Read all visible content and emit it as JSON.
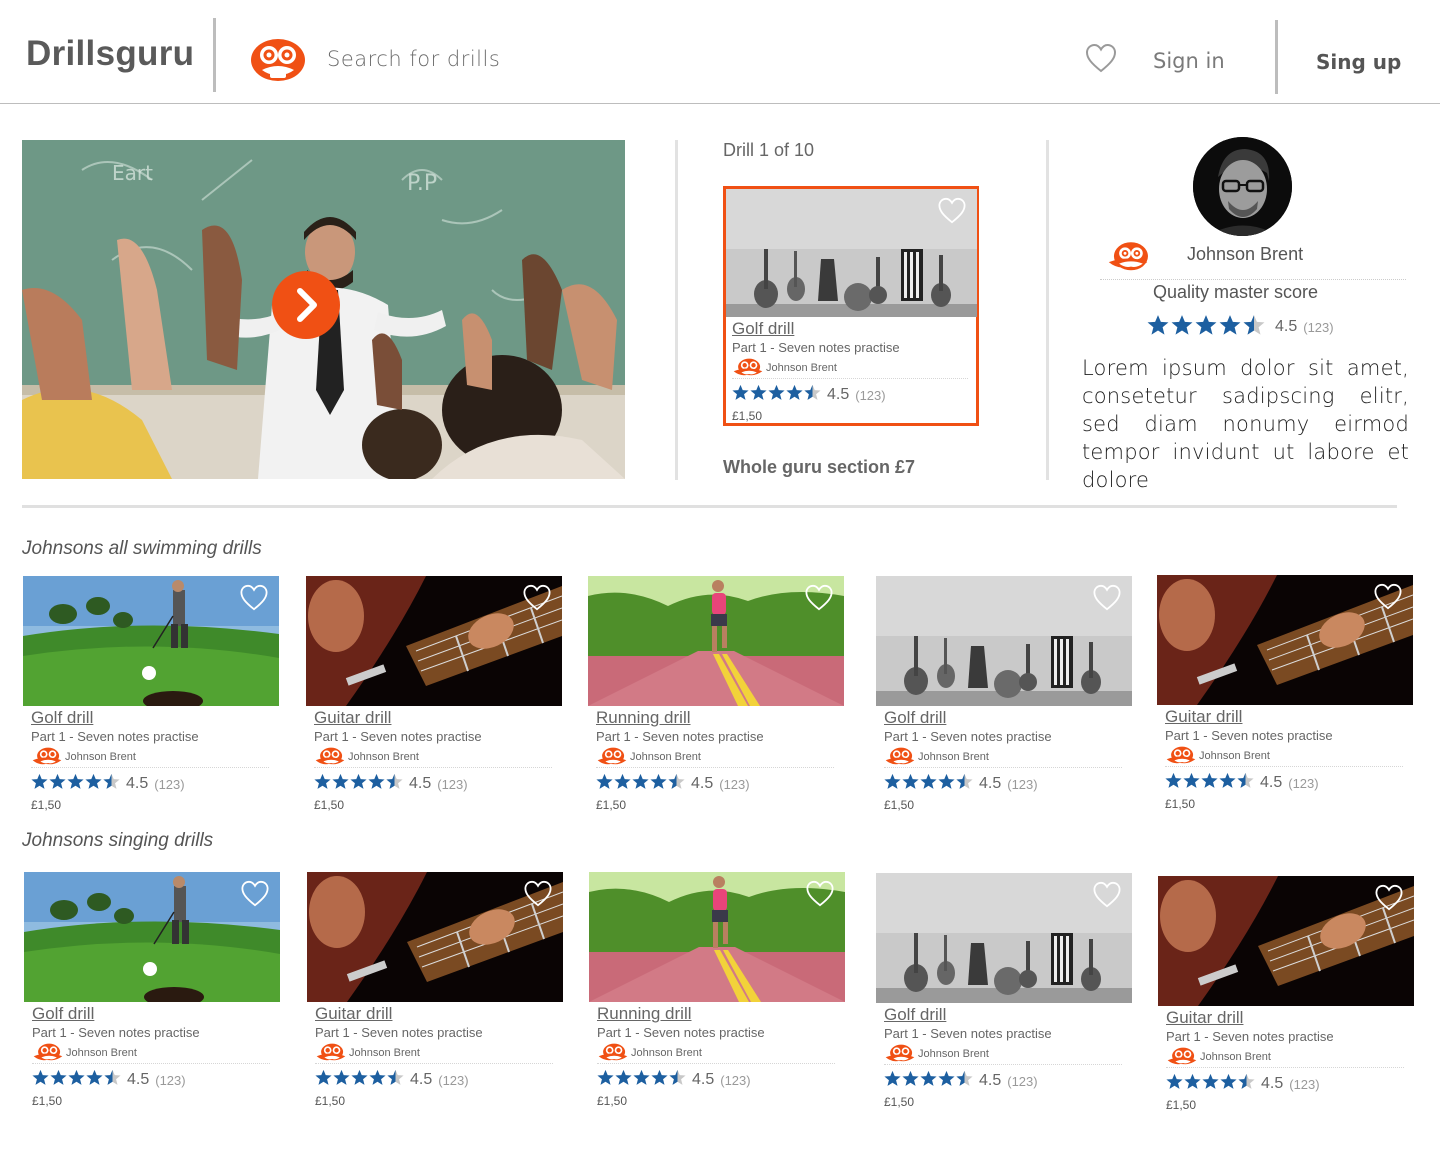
{
  "header": {
    "logo": "Drillsguru",
    "search_placeholder": "Search for drills",
    "sign_in": "Sign in",
    "sign_up": "Sing up"
  },
  "featured": {
    "counter": "Drill 1 of 10",
    "card": {
      "title": "Golf drill",
      "subtitle": "Part 1 - Seven notes practise",
      "author": "Johnson Brent",
      "rating": "4.5",
      "count": "(123)",
      "price": "£1,50",
      "image": "instruments"
    },
    "whole_section": "Whole guru section £7"
  },
  "profile": {
    "name": "Johnson Brent",
    "quality_label": "Quality master score",
    "rating": "4.5",
    "count": "(123)",
    "bio": "Lorem ipsum dolor sit amet, consetetur sadipscing elitr, sed diam nonumy eirmod tempor invidunt ut labore et dolore"
  },
  "sections": [
    {
      "title": "Johnsons all swimming drills",
      "cards": [
        {
          "title": "Golf drill",
          "subtitle": "Part 1 - Seven notes practise",
          "author": "Johnson Brent",
          "rating": "4.5",
          "count": "(123)",
          "price": "£1,50",
          "image": "golf"
        },
        {
          "title": "Guitar drill",
          "subtitle": "Part 1 - Seven notes practise",
          "author": "Johnson Brent",
          "rating": "4.5",
          "count": "(123)",
          "price": "£1,50",
          "image": "guitar"
        },
        {
          "title": "Running drill",
          "subtitle": "Part 1 - Seven notes practise",
          "author": "Johnson Brent",
          "rating": "4.5",
          "count": "(123)",
          "price": "£1,50",
          "image": "running"
        },
        {
          "title": "Golf drill",
          "subtitle": "Part 1 - Seven notes practise",
          "author": "Johnson Brent",
          "rating": "4.5",
          "count": "(123)",
          "price": "£1,50",
          "image": "instruments"
        },
        {
          "title": "Guitar drill",
          "subtitle": "Part 1 - Seven notes practise",
          "author": "Johnson Brent",
          "rating": "4.5",
          "count": "(123)",
          "price": "£1,50",
          "image": "guitar"
        }
      ]
    },
    {
      "title": "Johnsons singing drills",
      "cards": [
        {
          "title": "Golf drill",
          "subtitle": "Part 1 - Seven notes practise",
          "author": "Johnson Brent",
          "rating": "4.5",
          "count": "(123)",
          "price": "£1,50",
          "image": "golf"
        },
        {
          "title": "Guitar drill",
          "subtitle": "Part 1 - Seven notes practise",
          "author": "Johnson Brent",
          "rating": "4.5",
          "count": "(123)",
          "price": "£1,50",
          "image": "guitar"
        },
        {
          "title": "Running drill",
          "subtitle": "Part 1 - Seven notes practise",
          "author": "Johnson Brent",
          "rating": "4.5",
          "count": "(123)",
          "price": "£1,50",
          "image": "running"
        },
        {
          "title": "Golf drill",
          "subtitle": "Part 1 - Seven notes practise",
          "author": "Johnson Brent",
          "rating": "4.5",
          "count": "(123)",
          "price": "£1,50",
          "image": "instruments"
        },
        {
          "title": "Guitar drill",
          "subtitle": "Part 1 - Seven notes practise",
          "author": "Johnson Brent",
          "rating": "4.5",
          "count": "(123)",
          "price": "£1,50",
          "image": "guitar"
        }
      ]
    }
  ],
  "colors": {
    "accent": "#f05014",
    "star": "#1d5fa0",
    "star_empty": "#c8c8c8"
  },
  "icons": [
    "mascot-logo-icon",
    "heart-icon",
    "play-icon",
    "star-icon"
  ]
}
